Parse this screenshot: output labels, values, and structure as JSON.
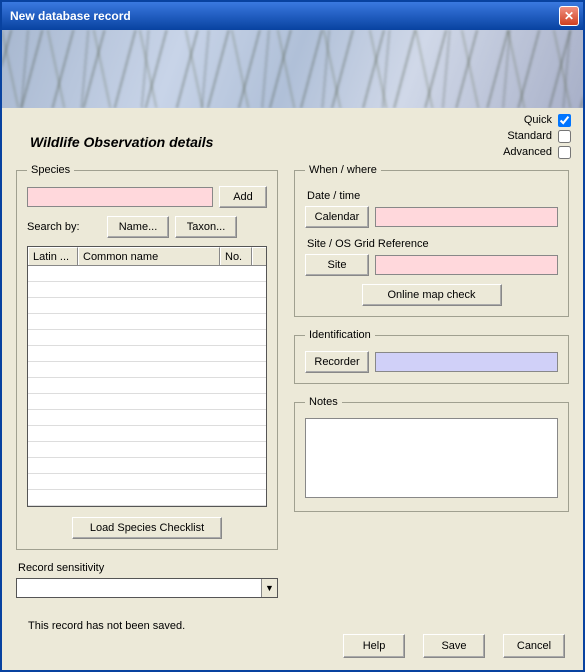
{
  "window": {
    "title": "New database record"
  },
  "viewOptions": {
    "quick": {
      "label": "Quick",
      "checked": true
    },
    "standard": {
      "label": "Standard",
      "checked": false
    },
    "advanced": {
      "label": "Advanced",
      "checked": false
    }
  },
  "page": {
    "title": "Wildlife Observation details"
  },
  "species": {
    "legend": "Species",
    "input_value": "",
    "add_label": "Add",
    "search_by_label": "Search by:",
    "name_btn": "Name...",
    "taxon_btn": "Taxon...",
    "columns": {
      "latin": "Latin ...",
      "common": "Common name",
      "no": "No."
    },
    "rows": [],
    "load_checklist_label": "Load Species Checklist"
  },
  "sensitivity": {
    "label": "Record sensitivity",
    "value": ""
  },
  "whenWhere": {
    "legend": "When / where",
    "datetime_label": "Date / time",
    "calendar_btn": "Calendar",
    "datetime_value": "",
    "site_label": "Site / OS Grid Reference",
    "site_btn": "Site",
    "site_value": "",
    "map_btn": "Online map check"
  },
  "identification": {
    "legend": "Identification",
    "recorder_btn": "Recorder",
    "recorder_value": ""
  },
  "notes": {
    "legend": "Notes",
    "value": ""
  },
  "status": {
    "message": "This record has not been saved."
  },
  "buttons": {
    "help": "Help",
    "save": "Save",
    "cancel": "Cancel"
  }
}
